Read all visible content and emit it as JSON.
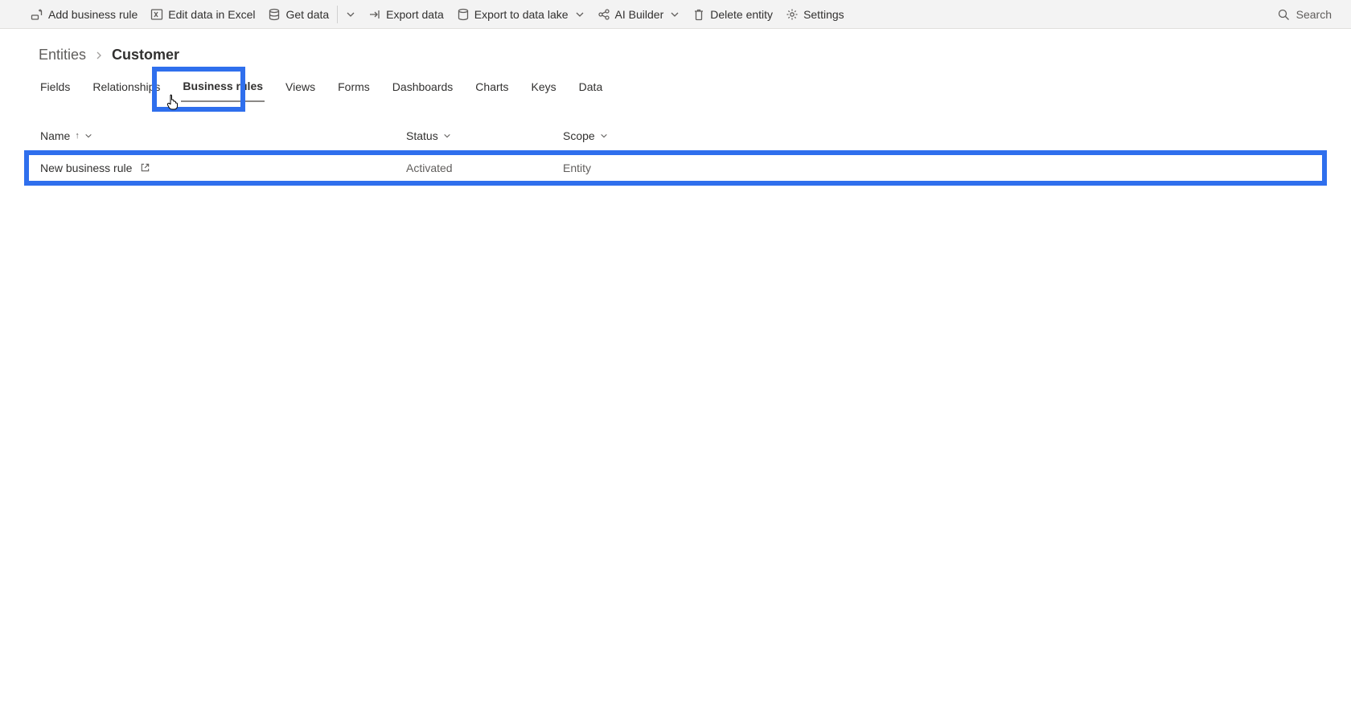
{
  "toolbar": {
    "add_business_rule": "Add business rule",
    "edit_excel": "Edit data in Excel",
    "get_data": "Get data",
    "export_data": "Export data",
    "export_lake": "Export to data lake",
    "ai_builder": "AI Builder",
    "delete_entity": "Delete entity",
    "settings": "Settings",
    "search_placeholder": "Search"
  },
  "breadcrumb": {
    "root": "Entities",
    "current": "Customer"
  },
  "tabs": {
    "fields": "Fields",
    "relationships": "Relationships",
    "business_rules": "Business rules",
    "views": "Views",
    "forms": "Forms",
    "dashboards": "Dashboards",
    "charts": "Charts",
    "keys": "Keys",
    "data": "Data"
  },
  "columns": {
    "name": "Name",
    "status": "Status",
    "scope": "Scope"
  },
  "rows": [
    {
      "name": "New business rule",
      "status": "Activated",
      "scope": "Entity"
    }
  ]
}
